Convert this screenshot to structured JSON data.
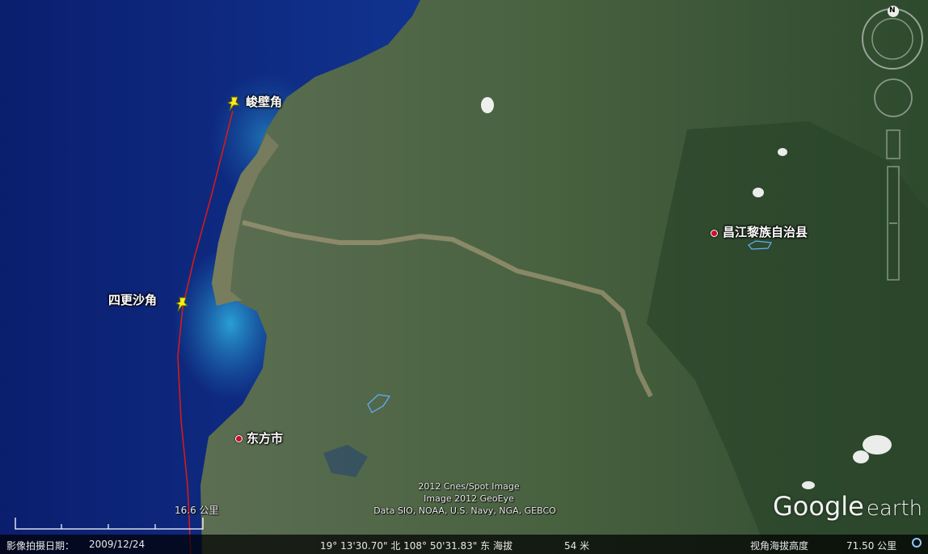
{
  "map": {
    "places": [
      {
        "name": "峻壁角",
        "type": "placemark-pin"
      },
      {
        "name": "四更沙角",
        "type": "placemark-pin"
      },
      {
        "name": "昌江黎族自治县",
        "type": "town"
      },
      {
        "name": "东方市",
        "type": "town"
      }
    ],
    "path_color": "#d61a1a"
  },
  "attribution": {
    "line1": "2012 Cnes/Spot Image",
    "line2": "Image     2012 GeoEye",
    "line3": "Data SIO, NOAA, U.S. Navy, NGA, GEBCO"
  },
  "scale": {
    "label": "16.6 公里"
  },
  "logo": {
    "google": "Google",
    "earth": "earth"
  },
  "compass": {
    "north": "N"
  },
  "statusbar": {
    "date_label": "影像拍摄日期：",
    "date": "2009/12/24",
    "coords": "19° 13'30.70\" 北 108° 50'31.83\" 东 海拔",
    "elevation": "54 米",
    "eye_label": "视角海拔高度",
    "eye_alt": "71.50 公里"
  }
}
